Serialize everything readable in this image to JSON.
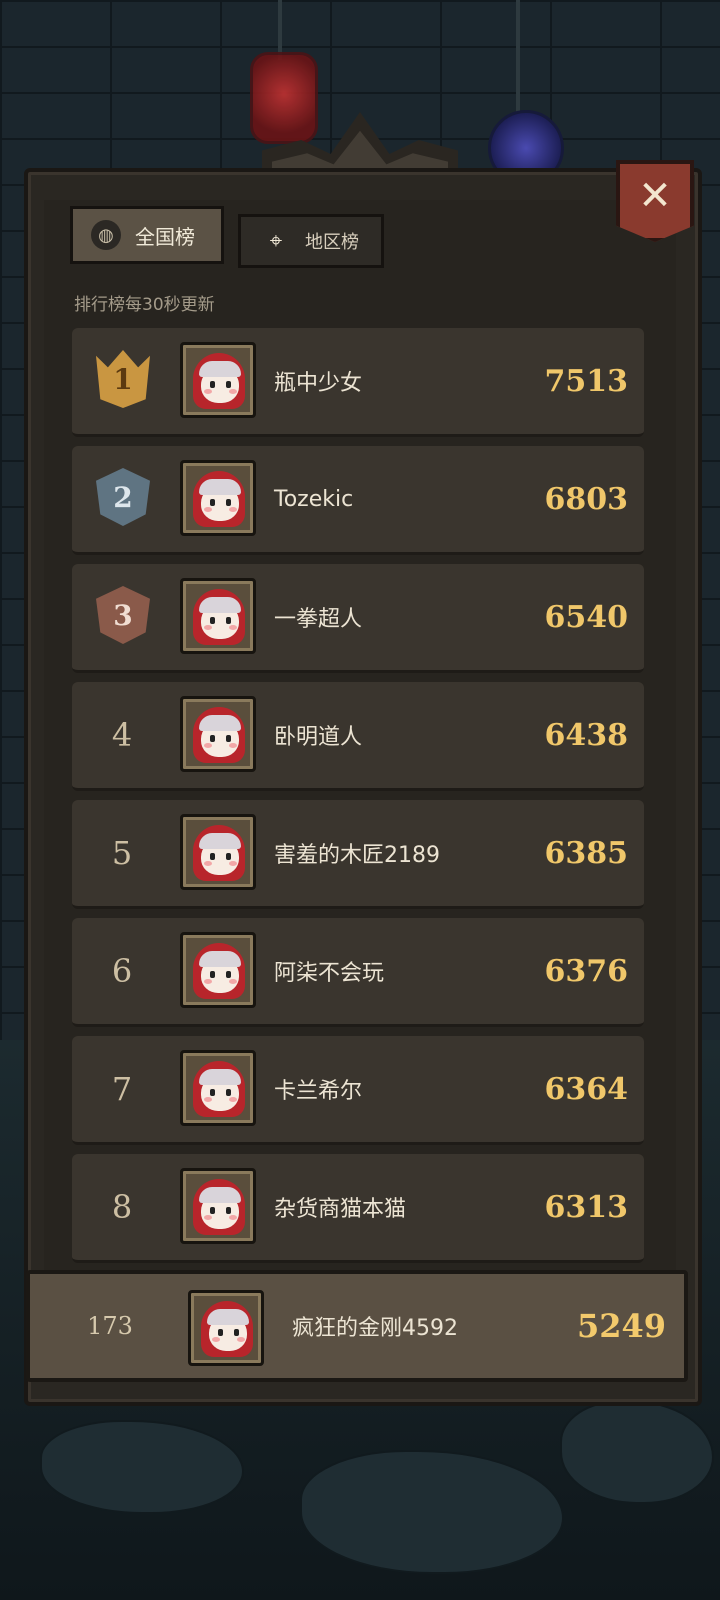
{
  "tabs": {
    "national_label": "全国榜",
    "region_label": "地区榜"
  },
  "refresh_note": "排行榜每30秒更新",
  "close_icon": "close-x-icon",
  "leaderboard": [
    {
      "rank": "1",
      "name": "瓶中少女",
      "score": "7513"
    },
    {
      "rank": "2",
      "name": "Tozekic",
      "score": "6803"
    },
    {
      "rank": "3",
      "name": "一拳超人",
      "score": "6540"
    },
    {
      "rank": "4",
      "name": "卧明道人",
      "score": "6438"
    },
    {
      "rank": "5",
      "name": "害羞的木匠2189",
      "score": "6385"
    },
    {
      "rank": "6",
      "name": "阿柒不会玩",
      "score": "6376"
    },
    {
      "rank": "7",
      "name": "卡兰希尔",
      "score": "6364"
    },
    {
      "rank": "8",
      "name": "杂货商猫本猫",
      "score": "6313"
    }
  ],
  "self": {
    "rank": "173",
    "name": "疯狂的金刚4592",
    "score": "5249"
  },
  "colors": {
    "panel": "#2a2722",
    "row": "#3a352e",
    "score_gold": "#f0c76a",
    "close_red": "#8a3a2e"
  }
}
